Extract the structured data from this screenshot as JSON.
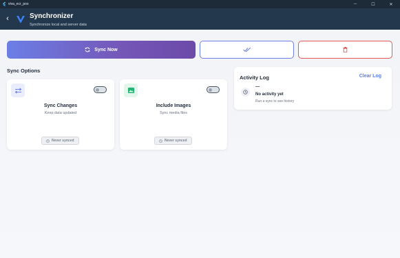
{
  "window": {
    "title": "viva_ecr_pos",
    "minimize_glyph": "─",
    "maximize_glyph": "☐",
    "close_glyph": "✕"
  },
  "appbar": {
    "back_glyph": "‹",
    "title": "Synchronizer",
    "subtitle": "Synchronize local and server data"
  },
  "actions": {
    "sync_now_label": "Sync Now",
    "upload_icon": "double-check-icon",
    "delete_icon": "trash-icon"
  },
  "sync_options": {
    "title": "Sync Options",
    "cards": [
      {
        "icon": "swap-arrows-icon",
        "title": "Sync Changes",
        "subtitle": "Keep data updated",
        "status": "Never synced",
        "enabled": false
      },
      {
        "icon": "image-icon",
        "title": "Include Images",
        "subtitle": "Sync media files",
        "status": "Never synced",
        "enabled": false
      }
    ]
  },
  "activity_log": {
    "title": "Activity Log",
    "clear_label": "Clear Log",
    "entry_dash": "—",
    "empty_title": "No activity yet",
    "empty_subtitle": "Run a sync to see history"
  },
  "colors": {
    "appbar_bg": "#23384c",
    "primary": "#6b7fe6",
    "accent_purple": "#7557b8",
    "danger": "#e35656",
    "green": "#22b573"
  }
}
